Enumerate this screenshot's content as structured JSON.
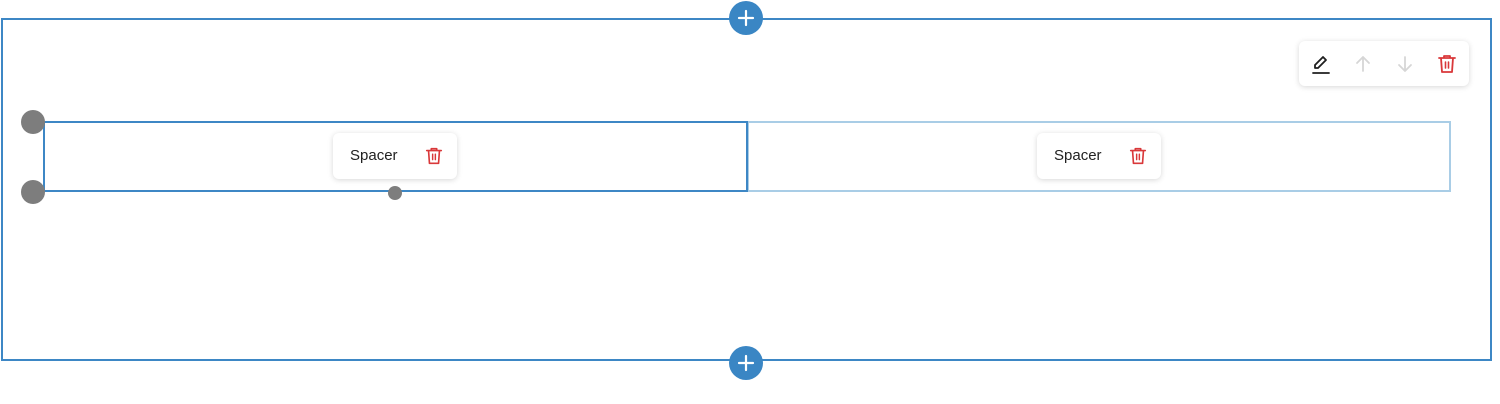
{
  "columns": [
    {
      "label": "Spacer"
    },
    {
      "label": "Spacer"
    }
  ],
  "toolbar": {
    "icons": [
      "edit-icon",
      "arrow-up-icon",
      "arrow-down-icon",
      "trash-icon"
    ]
  },
  "colors": {
    "accent": "#3a86c4",
    "selected_border": "#3d87c5",
    "muted_border": "#a9cde6",
    "delete": "#d9383a",
    "handle": "#7d7d7d"
  }
}
